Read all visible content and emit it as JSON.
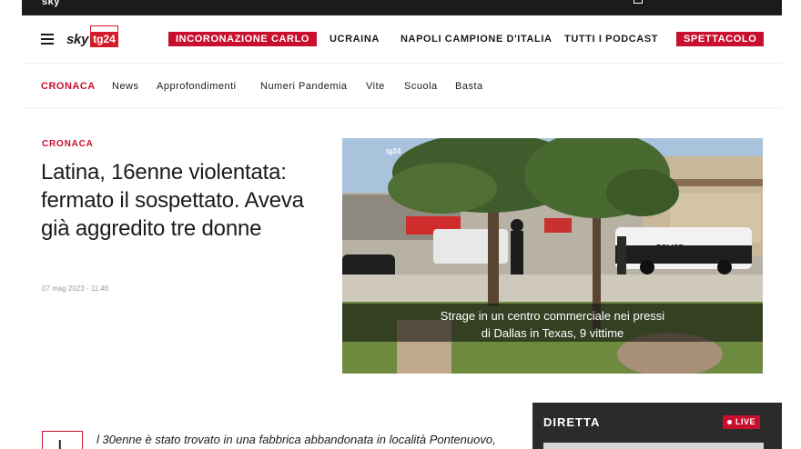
{
  "topbar": {
    "brand_fragment": "sky"
  },
  "nav": {
    "logo_sky": "sky",
    "logo_tg": "tg24",
    "items": [
      {
        "label": "INCORONAZIONE CARLO",
        "highlight": true
      },
      {
        "label": "UCRAINA",
        "highlight": false
      },
      {
        "label": "NAPOLI CAMPIONE D'ITALIA",
        "highlight": false
      },
      {
        "label": "TUTTI I PODCAST",
        "highlight": false
      },
      {
        "label": "SPETTACOLO",
        "highlight": true
      }
    ]
  },
  "subnav": {
    "active": "CRONACA",
    "items": [
      "News",
      "Approfondimenti",
      "Numeri Pandemia",
      "Vite",
      "Scuola",
      "Basta"
    ]
  },
  "article": {
    "section": "CRONACA",
    "headline": "Latina, 16enne violentata: fermato il sospettato. Aveva già aggredito tre donne",
    "timestamp": "07 mag 2023 - 11:46",
    "dropcap": "I",
    "body_first_line": "l 30enne è stato trovato in una fabbrica abbandonata in località Pontenuovo,"
  },
  "video": {
    "watermark": "tg24",
    "caption_line1": "Strage in un centro commerciale nei pressi",
    "caption_line2": "di Dallas in Texas, 9 vittime",
    "police_text": "POLICE"
  },
  "live": {
    "title": "DIRETTA",
    "badge": "LIVE"
  },
  "colors": {
    "accent_red": "#c8102e",
    "topbar": "#1b1b1b",
    "live_panel": "#2b2b2b"
  }
}
